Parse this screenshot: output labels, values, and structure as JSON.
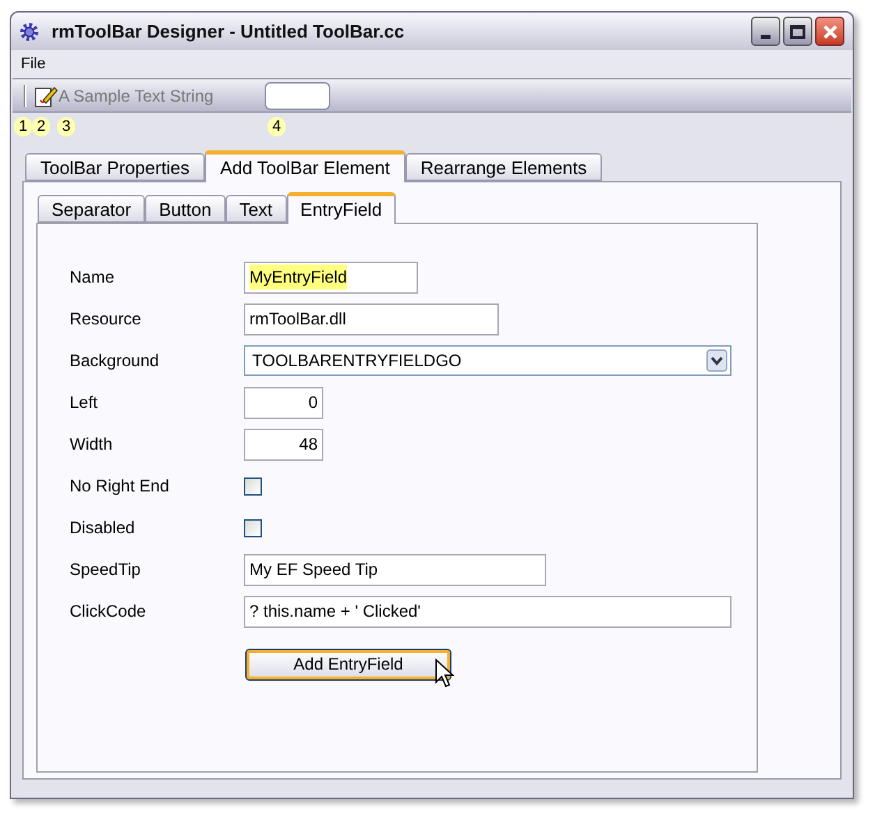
{
  "window": {
    "title": "rmToolBar Designer -  Untitled ToolBar.cc"
  },
  "menu": [
    "File"
  ],
  "toolbar": {
    "items": [
      {
        "kind": "separator",
        "badge": "1"
      },
      {
        "kind": "button",
        "badge": "2"
      },
      {
        "kind": "text",
        "text": "A Sample Text String",
        "badge": "3"
      },
      {
        "kind": "entryfield",
        "badge": "4"
      }
    ]
  },
  "tabs": [
    {
      "label": "ToolBar Properties",
      "selected": false
    },
    {
      "label": "Add ToolBar Element",
      "selected": true
    },
    {
      "label": "Rearrange Elements",
      "selected": false
    }
  ],
  "subtabs": [
    {
      "label": "Separator",
      "selected": false
    },
    {
      "label": "Button",
      "selected": false
    },
    {
      "label": "Text",
      "selected": false
    },
    {
      "label": "EntryField",
      "selected": true
    }
  ],
  "fields": [
    {
      "label": "Name",
      "kind": "text",
      "value": "MyEntryField",
      "highlighted": true
    },
    {
      "label": "Resource",
      "kind": "text",
      "value": "rmToolBar.dll",
      "highlighted": false
    },
    {
      "label": "Background",
      "kind": "combo",
      "value": "TOOLBARENTRYFIELDGO",
      "highlighted": false
    },
    {
      "label": "Left",
      "kind": "number",
      "value": "0",
      "highlighted": false
    },
    {
      "label": "Width",
      "kind": "number",
      "value": "48",
      "highlighted": false
    },
    {
      "label": "No Right End",
      "kind": "checkbox",
      "checked": false
    },
    {
      "label": "Disabled",
      "kind": "checkbox",
      "checked": false
    },
    {
      "label": "SpeedTip",
      "kind": "text",
      "value": "My EF Speed Tip",
      "highlighted": false
    },
    {
      "label": "ClickCode",
      "kind": "text",
      "value": "? this.name + ' Clicked'",
      "highlighted": false
    }
  ],
  "add_button": "Add EntryField"
}
